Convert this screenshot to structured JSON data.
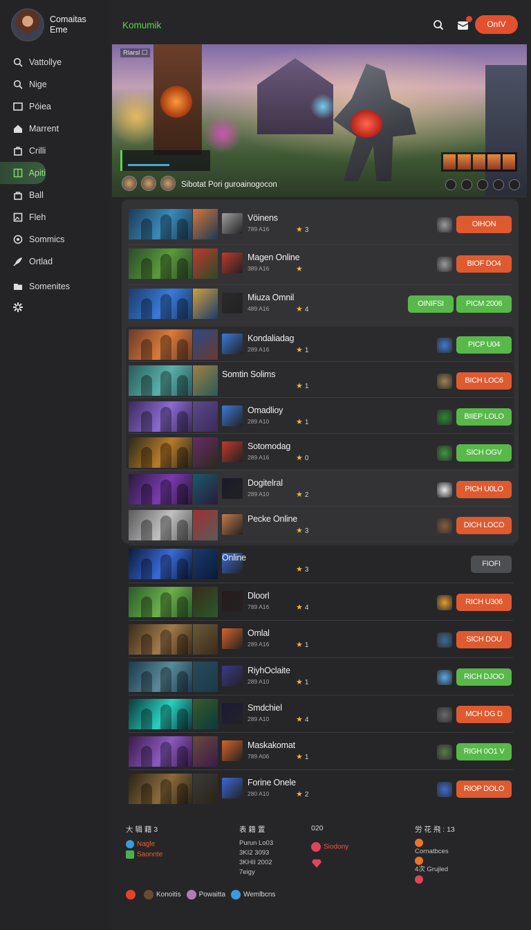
{
  "profile": {
    "name_line1": "Comaitas",
    "name_line2": "Eme"
  },
  "sidebar": {
    "items": [
      {
        "label": "Vattollye",
        "icon": "search-icon"
      },
      {
        "label": "Nige",
        "icon": "search-icon"
      },
      {
        "label": "Póiea",
        "icon": "window-icon"
      },
      {
        "label": "Marrent",
        "icon": "home-icon"
      },
      {
        "label": "Crilli",
        "icon": "bag-icon"
      },
      {
        "label": "Apiti",
        "icon": "grid-icon",
        "active": true
      },
      {
        "label": "Ball",
        "icon": "lock-icon"
      },
      {
        "label": "Fleh",
        "icon": "image-icon"
      },
      {
        "label": "Sommics",
        "icon": "settings-circle-icon"
      },
      {
        "label": "Ortlad",
        "icon": "rocket-icon"
      },
      {
        "label": "Somenites",
        "icon": "folder-icon"
      }
    ]
  },
  "header": {
    "brand": "Komumik",
    "online_button": "OnIV"
  },
  "hero": {
    "tag": "Rlarsl ☐",
    "caption": "Sibotat Pori guroainogocon"
  },
  "games": [
    {
      "title": "Vöinens",
      "meta": "789 A16",
      "rating": "3",
      "action": "OIHON",
      "action_style": "orange"
    },
    {
      "title": "Magen Online",
      "meta": "389 A16",
      "rating": "",
      "action": "BIOF DO4",
      "action_style": "orange"
    },
    {
      "title": "Miuza Omnil",
      "meta": "489 A16",
      "rating": "4",
      "action2": "OINIFSI",
      "action": "PICM 2006",
      "action_style": "green"
    },
    {
      "title": "Kondaliadag",
      "meta": "289 A16",
      "rating": "1",
      "action": "PICP U04",
      "action_style": "green"
    },
    {
      "title": "Somtin Solims",
      "meta": "",
      "rating": "1",
      "action": "BICH LOC6",
      "action_style": "orange"
    },
    {
      "title": "Omadlioy",
      "meta": "289 A10",
      "rating": "1",
      "action": "BIIEP LOLO",
      "action_style": "green"
    },
    {
      "title": "Sotomodag",
      "meta": "289 A16",
      "rating": "0",
      "action": "SICH OGV",
      "action_style": "green"
    },
    {
      "title": "Dogitelral",
      "meta": "289 A10",
      "rating": "2",
      "action": "PICH U0LO",
      "action_style": "orange"
    },
    {
      "title": "Pecke Online",
      "meta": "",
      "rating": "3",
      "action": "DICH LOCO",
      "action_style": "orange"
    },
    {
      "title": "Online",
      "meta": "",
      "rating": "3",
      "action": "FIOFI",
      "action_style": "gray"
    },
    {
      "title": "Dloorl",
      "meta": "789 A16",
      "rating": "4",
      "action": "RICH U306",
      "action_style": "orange"
    },
    {
      "title": "Omlal",
      "meta": "289 A16",
      "rating": "1",
      "action": "SICH DOU",
      "action_style": "orange"
    },
    {
      "title": "RiyhOclaite",
      "meta": "289 A10",
      "rating": "1",
      "action": "RICH DJOO",
      "action_style": "green"
    },
    {
      "title": "Smdchiel",
      "meta": "289 A10",
      "rating": "4",
      "action": "MCH DG D",
      "action_style": "orange"
    },
    {
      "title": "Maskakomat",
      "meta": "789 A06",
      "rating": "1",
      "action": "RIGH 0O1 V",
      "action_style": "green"
    },
    {
      "title": "Forine Onele",
      "meta": "280 A10",
      "rating": "2",
      "action": "RIOP DOLO",
      "action_style": "orange"
    }
  ],
  "footer": {
    "col1": {
      "title": "大 辑 藉 3",
      "link1": "Nagle",
      "link2": "Saonnte"
    },
    "col2": {
      "title": "表 籍 置",
      "lines": [
        "Purun Lo03",
        "3KI2 3093",
        "3KHII 2002",
        "7eigy"
      ]
    },
    "col3": {
      "title": "020",
      "link1": "Siodony"
    },
    "col4": {
      "title": "労 花 飛 : 13",
      "line1": "Cornatbces",
      "line2": "4次 Grujled"
    },
    "bottom": {
      "item1": "Konoitis",
      "item2": "Powaitta",
      "item3": "Wemlbcns"
    }
  },
  "colors": {
    "accent_green": "#59d64b",
    "accent_orange": "#e05a30",
    "button_green": "#58b94a"
  }
}
